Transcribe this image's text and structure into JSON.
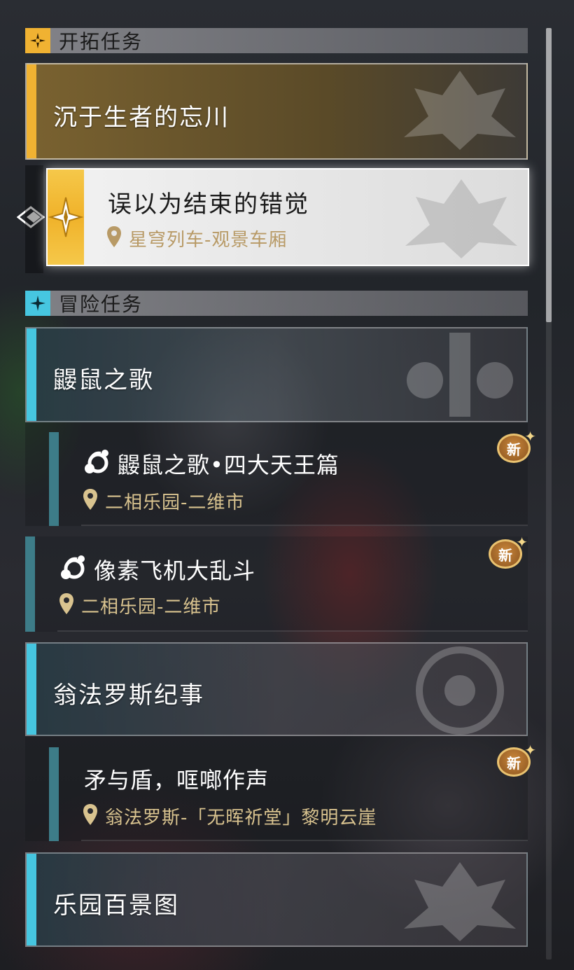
{
  "sections": {
    "trailblaze": {
      "title": "开拓任务"
    },
    "adventure": {
      "title": "冒险任务"
    }
  },
  "trailblaze_main": {
    "title": "沉于生者的忘川"
  },
  "active_quest": {
    "title": "误以为结束的错觉",
    "location": "星穹列车-观景车厢"
  },
  "adventure_groups": [
    {
      "title": "鼹鼠之歌"
    },
    {
      "title": "翁法罗斯纪事"
    },
    {
      "title": "乐园百景图"
    }
  ],
  "adventure_items": [
    {
      "title": "鼹鼠之歌•四大天王篇",
      "location": "二相乐园-二维市",
      "badge": "新"
    },
    {
      "title": "像素飞机大乱斗",
      "location": "二相乐园-二维市",
      "badge": "新"
    },
    {
      "title": "矛与盾，哐啷作声",
      "location": "翁法罗斯-「无晖祈堂」黎明云崖",
      "badge": "新"
    }
  ],
  "colors": {
    "trailblaze_accent": "#f0b232",
    "adventure_accent": "#46c6e0",
    "location_text": "#d9c38f"
  },
  "icons": [
    "trailblaze-star-icon",
    "adventure-star-icon",
    "location-pin-icon",
    "activity-icon",
    "selected-arrow-icon",
    "new-badge-icon"
  ]
}
